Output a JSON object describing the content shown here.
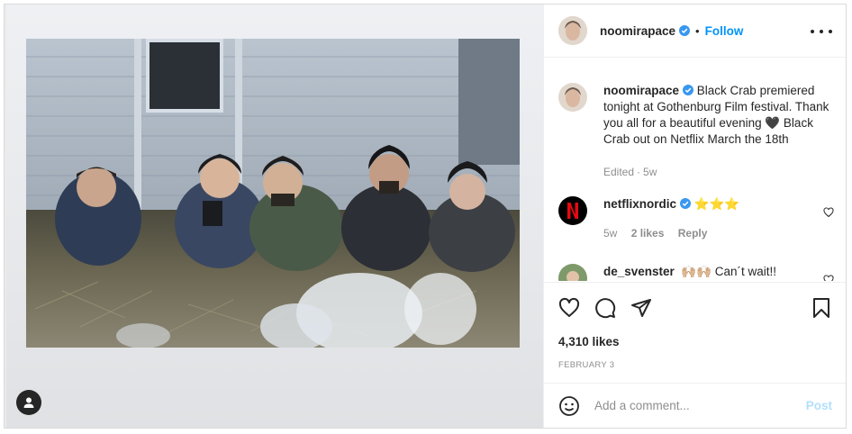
{
  "post": {
    "author": {
      "username": "noomirapace",
      "verified": true,
      "follow_label": "Follow",
      "separator": "•"
    },
    "caption": {
      "username": "noomirapace",
      "text": "Black Crab premiered tonight at Gothenburg Film festival. Thank you all for a beautiful evening 🖤 Black Crab out on Netflix March the 18th",
      "edited_label": "Edited",
      "time": "5w"
    },
    "comments": [
      {
        "username": "netflixnordic",
        "verified": true,
        "text": "⭐⭐⭐",
        "time": "5w",
        "likes": "2 likes",
        "reply_label": "Reply"
      },
      {
        "username": "de_svenster",
        "verified": false,
        "text": "🙌🏼🙌🏼 Can´t wait!!"
      }
    ],
    "likes_count": "4,310 likes",
    "date": "FEBRUARY 3",
    "add_comment": {
      "placeholder": "Add a comment...",
      "post_label": "Post"
    }
  },
  "icons": {
    "like": "heart-icon",
    "comment": "comment-icon",
    "share": "paper-plane-icon",
    "save": "bookmark-icon",
    "emoji": "emoji-icon",
    "more": "more-options-icon",
    "user_tag": "user-tag-icon"
  },
  "colors": {
    "accent": "#0095f6",
    "post_disabled": "#b2dffc",
    "netflix_red": "#e50914",
    "muted": "#8e8e8e"
  }
}
